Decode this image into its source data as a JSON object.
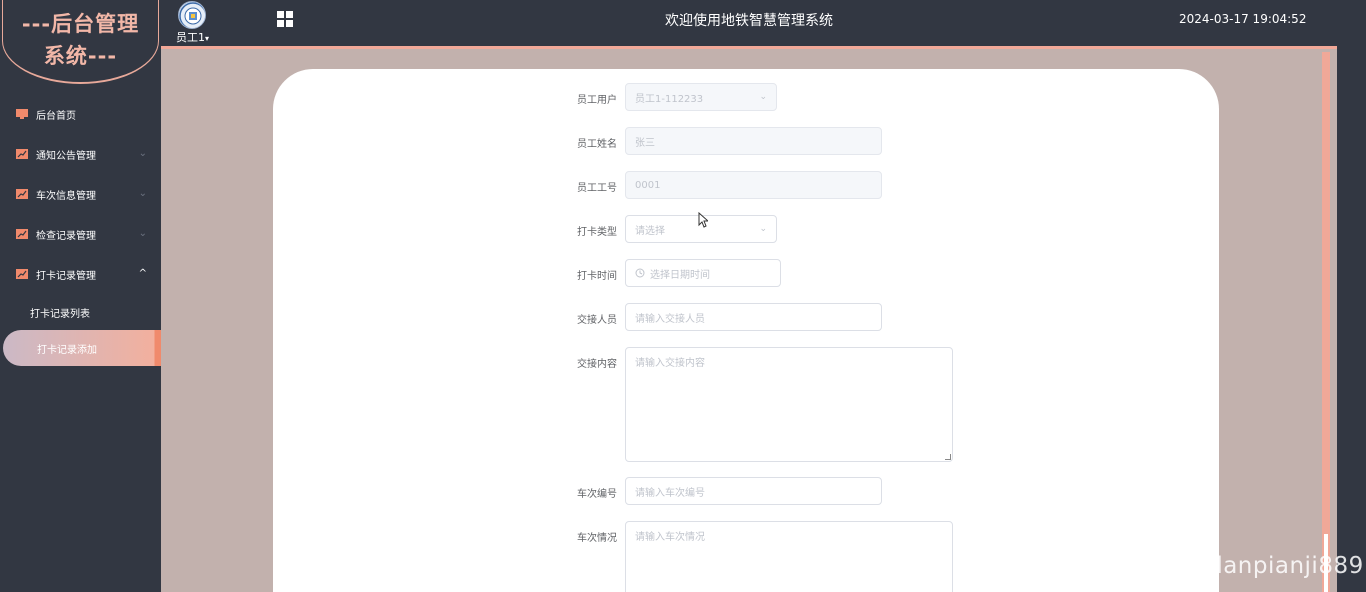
{
  "brand": {
    "line1": "---后台管理",
    "line2": "系统---"
  },
  "header": {
    "user_label": "员工1",
    "dropdown_glyph": "▾",
    "title": "欢迎使用地铁智慧管理系统",
    "datetime": "2024-03-17 19:04:52"
  },
  "sidebar": {
    "items": [
      {
        "label": "后台首页",
        "icon": "monitor-icon",
        "chevron": ""
      },
      {
        "label": "通知公告管理",
        "icon": "chart-icon",
        "chevron": "⌄"
      },
      {
        "label": "车次信息管理",
        "icon": "chart-icon",
        "chevron": "⌄"
      },
      {
        "label": "检查记录管理",
        "icon": "chart-icon",
        "chevron": "⌄"
      },
      {
        "label": "打卡记录管理",
        "icon": "chart-icon",
        "chevron": "^"
      }
    ],
    "sub_items": [
      {
        "label": "打卡记录列表",
        "active": false
      },
      {
        "label": "打卡记录添加",
        "active": true
      }
    ]
  },
  "form": {
    "employee_user": {
      "label": "员工用户",
      "value": "员工1-112233"
    },
    "employee_name": {
      "label": "员工姓名",
      "value": "张三"
    },
    "employee_no": {
      "label": "员工工号",
      "value": "0001"
    },
    "clock_type": {
      "label": "打卡类型",
      "placeholder": "请选择"
    },
    "clock_time": {
      "label": "打卡时间",
      "placeholder": "选择日期时间"
    },
    "handover_person": {
      "label": "交接人员",
      "placeholder": "请输入交接人员"
    },
    "handover_content": {
      "label": "交接内容",
      "placeholder": "请输入交接内容"
    },
    "train_no": {
      "label": "车次编号",
      "placeholder": "请输入车次编号"
    },
    "train_status": {
      "label": "车次情况",
      "placeholder": "请输入车次情况"
    }
  },
  "watermark": "CSDN @vx_danpianji889",
  "colors": {
    "sidebar_bg": "#323742",
    "accent": "#f2a898",
    "main_bg": "#c2b1ad",
    "brand_text": "#f2b7a8"
  }
}
